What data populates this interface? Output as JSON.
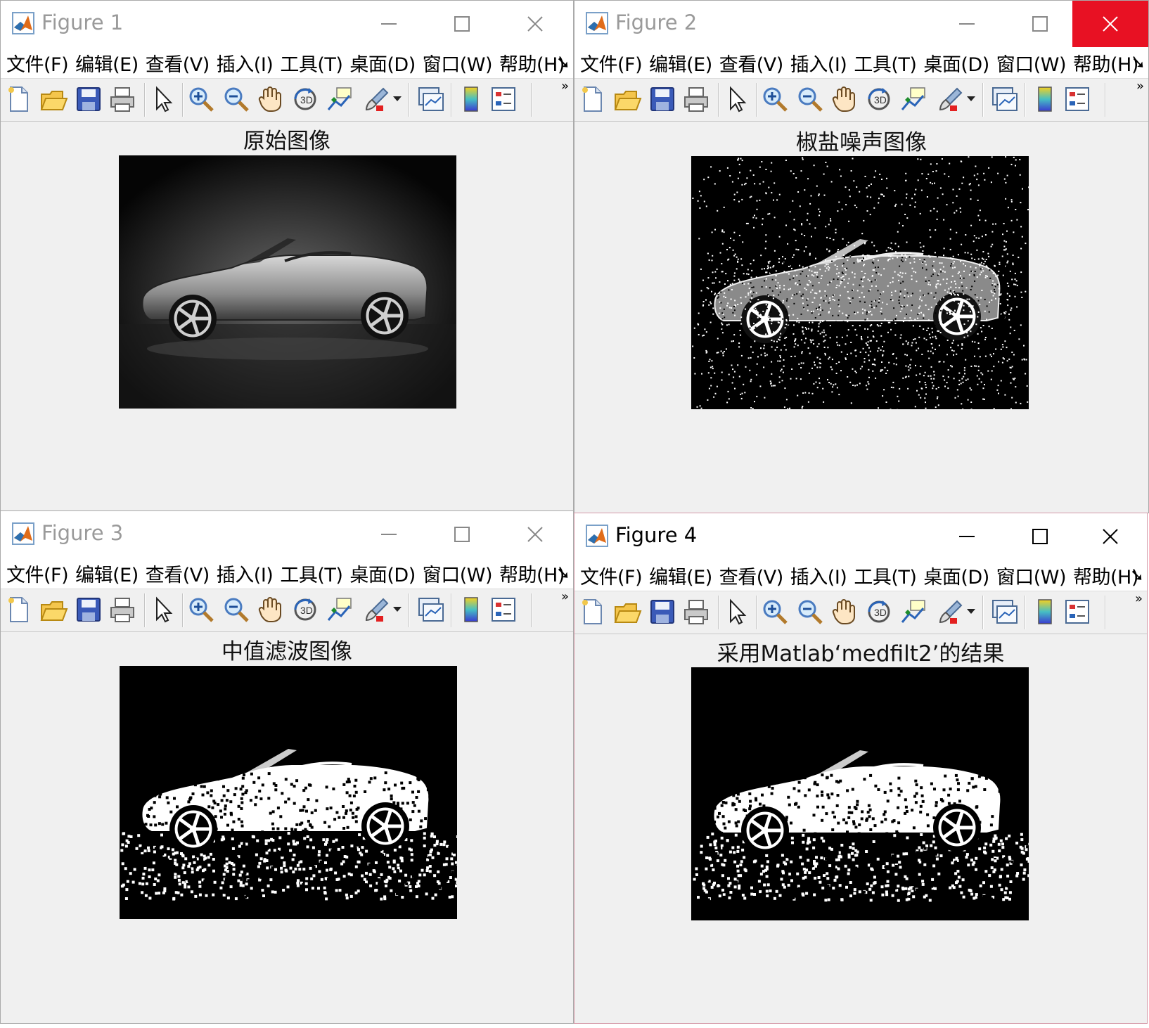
{
  "menu": [
    "文件(F)",
    "编辑(E)",
    "查看(V)",
    "插入(I)",
    "工具(T)",
    "桌面(D)",
    "窗口(W)",
    "帮助(H)"
  ],
  "menu_more": "➘",
  "toolbar_more": "»",
  "toolbar_icons": [
    "new-figure-icon",
    "open-file-icon",
    "save-icon",
    "print-icon",
    "select-arrow-icon",
    "zoom-in-icon",
    "zoom-out-icon",
    "pan-hand-icon",
    "rotate-3d-icon",
    "data-cursor-icon",
    "brush-icon",
    "link-plot-icon",
    "colorbar-icon",
    "legend-icon"
  ],
  "colors": {
    "window_bg": "#f0f0f0",
    "close_hover": "#e81123",
    "titlebar": "#ffffff"
  },
  "windows": [
    {
      "id": "figure-1",
      "title": "Figure 1",
      "axes_title": "原始图像",
      "image": "grayscale-car",
      "active": false,
      "close_hot": false
    },
    {
      "id": "figure-2",
      "title": "Figure 2",
      "axes_title": "椒盐噪声图像",
      "image": "salt-pepper-car",
      "active": false,
      "close_hot": true
    },
    {
      "id": "figure-3",
      "title": "Figure 3",
      "axes_title": "中值滤波图像",
      "image": "median-filtered-car",
      "active": false,
      "close_hot": false
    },
    {
      "id": "figure-4",
      "title": "Figure 4",
      "axes_title": "采用Matlab‘medfilt2’的结果",
      "image": "medfilt2-car",
      "active": true,
      "close_hot": false
    }
  ]
}
